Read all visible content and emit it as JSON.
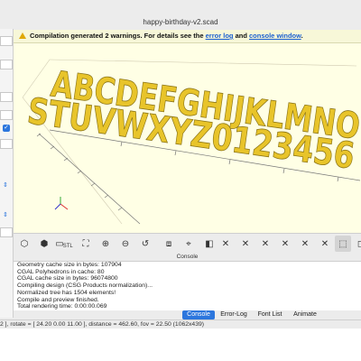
{
  "window": {
    "title": "happy-birthday-v2.scad"
  },
  "notice": {
    "message": "Compilation generated 2 warnings. For details see the",
    "error_log_link": "error log",
    "and_text": "and",
    "console_link": "console window",
    "period": "."
  },
  "scene": {
    "row1": "ABCDEFGHIJKLMNO",
    "row2": "STUVWXYZ0123456",
    "letter_color": "#e8c42a",
    "background": "#ffffe5"
  },
  "toolbar": {
    "buttons": [
      "render",
      "preview",
      "export-stl",
      "view-all",
      "zoom-in",
      "zoom-out",
      "reset-view",
      "show-edges",
      "view-right",
      "view-top",
      "view-bottom",
      "view-left",
      "view-front",
      "view-back",
      "view-diagonal",
      "view-center",
      "perspective",
      "orthogonal"
    ],
    "stl_label": "STL"
  },
  "console": {
    "header": "Console",
    "lines": [
      "Geometry cache size in bytes: 107904",
      "CGAL Polyhedrons in cache: 80",
      "CGAL cache size in bytes: 96074800",
      "Compiling design (CSG Products normalization)...",
      "Normalized tree has 1504 elements!",
      "Compile and preview finished.",
      "Total rendering time: 0:00:00.069"
    ]
  },
  "tabs": [
    "Console",
    "Error-Log",
    "Font List",
    "Animate"
  ],
  "status": "2 ], rotate = [ 24.20 0.00 11.00 ], distance = 462.60, fov = 22.50 (1062x439)"
}
